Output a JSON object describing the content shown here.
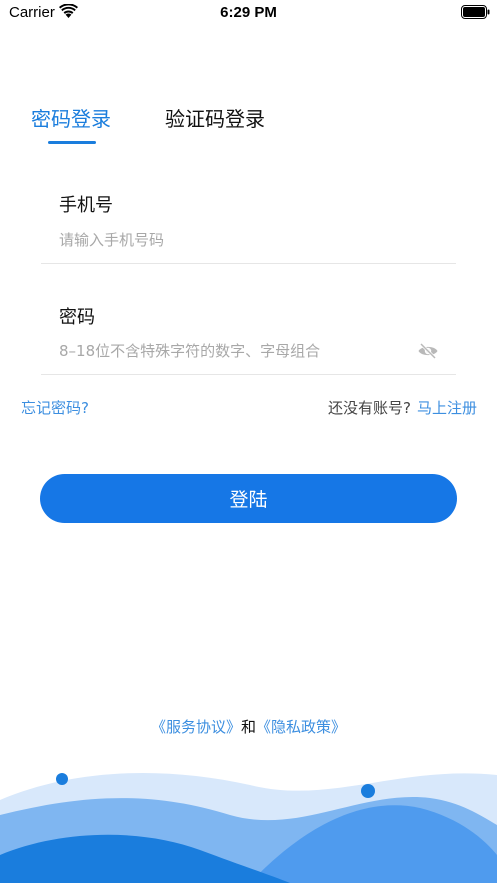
{
  "status_bar": {
    "carrier": "Carrier",
    "time": "6:29 PM",
    "wifi_icon": "wifi-icon",
    "battery_icon": "battery-icon"
  },
  "tabs": [
    {
      "label": "密码登录",
      "active": true
    },
    {
      "label": "验证码登录",
      "active": false
    }
  ],
  "form": {
    "phone": {
      "label": "手机号",
      "value": "",
      "placeholder": "请输入手机号码"
    },
    "password": {
      "label": "密码",
      "value": "",
      "placeholder": "8–18位不含特殊字符的数字、字母组合",
      "toggle_icon": "eye-hidden-icon"
    }
  },
  "links": {
    "forgot_password": "忘记密码?",
    "no_account": "还没有账号?",
    "register": "马上注册"
  },
  "login_button": "登陆",
  "agreement": {
    "service": "《服务协议》",
    "and": "和",
    "privacy": "《隐私政策》"
  },
  "colors": {
    "accent": "#1a7ddd",
    "button": "#1677e6",
    "link": "#3d8fe0",
    "placeholder": "#a8a8a8",
    "wave_light": "#d5e7fa",
    "wave_mid": "#7db6f2",
    "wave_dark": "#1a7ddd"
  }
}
